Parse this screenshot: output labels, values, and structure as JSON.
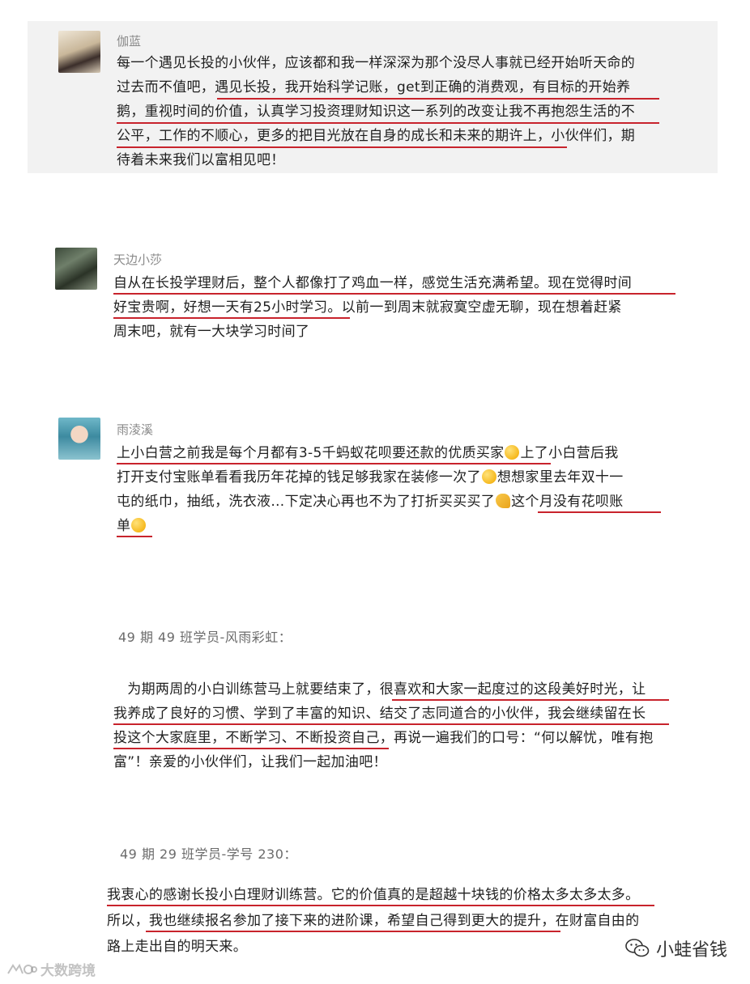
{
  "comments": [
    {
      "name": "伽蓝",
      "lines": [
        "每一个遇见长投的小伙伴，应该都和我一样深深为那个没尽人事就已经开始听天命的",
        "过去而不值吧，遇见长投，我开始科学记账，get到正确的消费观，有目标的开始养",
        "鹅，重视时间的价值，认真学习投资理财知识这一系列的改变让我不再抱怨生活的不",
        "公平，工作的不顺心，更多的把目光放在自身的成长和未来的期许上，小伙伴们，期",
        "待着未来我们以富相见吧！"
      ]
    },
    {
      "name": "天边小莎",
      "lines": [
        "自从在长投学理财后，整个人都像打了鸡血一样，感觉生活充满希望。现在觉得时间",
        "好宝贵啊，好想一天有25小时学习。以前一到周末就寂寞空虚无聊，现在想着赶紧",
        "周末吧，就有一大块学习时间了"
      ]
    },
    {
      "name": "雨淩溪",
      "lines": [
        [
          "上小白营之前我是每个月都有3-5千蚂蚁花呗要还款的优质买家",
          "上了小白营后我"
        ],
        [
          "打开支付宝账单看看我历年花掉的钱足够我家在装修一次了",
          "想想家里去年双十一"
        ],
        [
          "屯的纸巾，抽纸，洗衣液…下定决心再也不为了打折买买买了",
          "这个月没有花呗账"
        ],
        [
          "单",
          ""
        ]
      ]
    }
  ],
  "testimonials": [
    {
      "header": "49 期 49 班学员-风雨彩虹：",
      "lines": [
        "　为期两周的小白训练营马上就要结束了，很喜欢和大家一起度过的这段美好时光，让",
        "我养成了良好的习惯、学到了丰富的知识、结交了志同道合的小伙伴，我会继续留在长",
        "投这个大家庭里，不断学习、不断投资自己，再说一遍我们的口号：“何以解忧，唯有抱",
        "富”！亲爱的小伙伴们，让我们一起加油吧！"
      ]
    },
    {
      "header": "49 期 29 班学员-学号 230：",
      "lines": [
        "我衷心的感谢长投小白理财训练营。它的价值真的是超越十块钱的价格太多太多太多。",
        "所以，我也继续报名参加了接下来的进阶课，希望自己得到更大的提升，在财富自由的",
        "路上走出自的明天来。"
      ]
    }
  ],
  "brand": {
    "name": "小蛙省钱",
    "icon": "wechat-icon"
  },
  "watermark": {
    "text": "大数跨境",
    "icon": "watermark-logo"
  },
  "colors": {
    "underline": "#c8232c",
    "card_bg": "#f2f2f2",
    "name_gray": "#8a8a8a"
  }
}
